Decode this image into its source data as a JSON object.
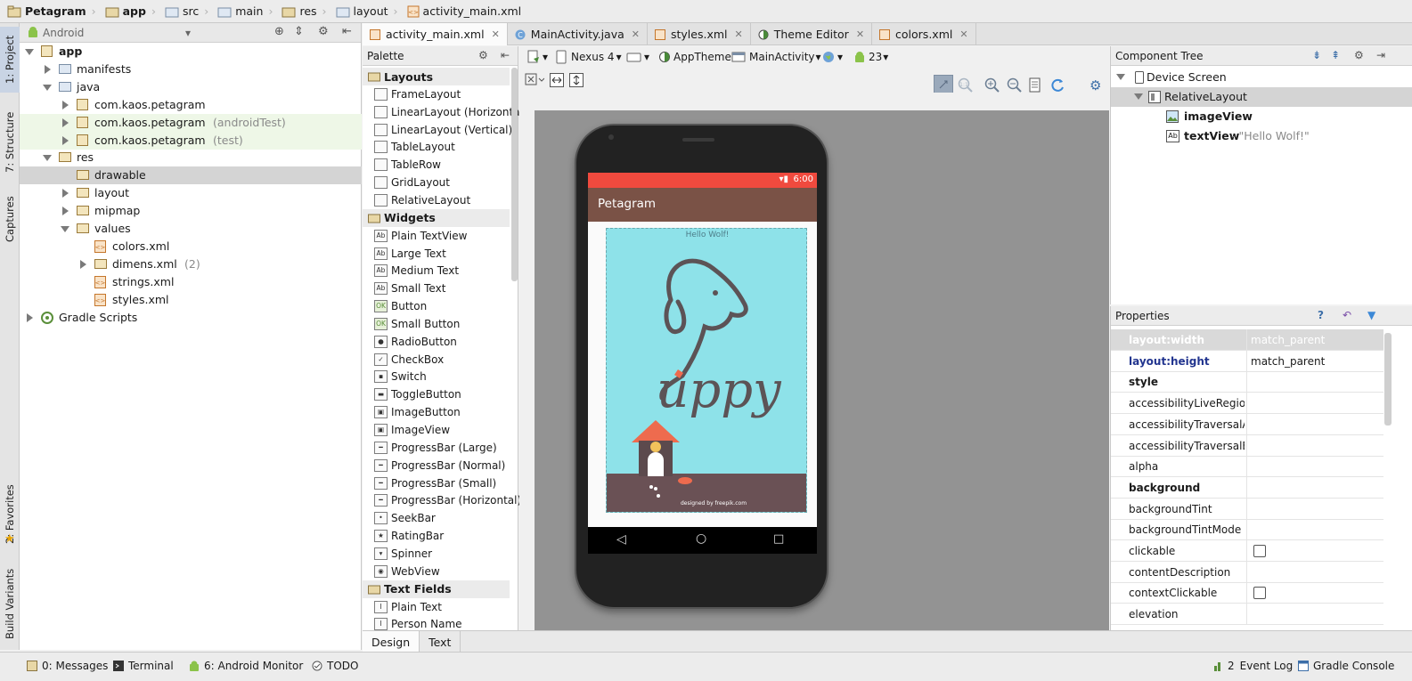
{
  "breadcrumb": [
    "Petagram",
    "app",
    "src",
    "main",
    "res",
    "layout",
    "activity_main.xml"
  ],
  "side_tabs": {
    "project": "1: Project",
    "structure": "7: Structure",
    "captures": "Captures",
    "favorites": "2: Favorites",
    "build_variants": "Build Variants"
  },
  "project_panel": {
    "view_selector": "Android"
  },
  "tree": [
    {
      "label": "app",
      "bold": true
    },
    {
      "label": "manifests"
    },
    {
      "label": "java"
    },
    {
      "label": "com.kaos.petagram",
      "suffix": ""
    },
    {
      "label": "com.kaos.petagram",
      "suffix": "(androidTest)"
    },
    {
      "label": "com.kaos.petagram",
      "suffix": "(test)"
    },
    {
      "label": "res"
    },
    {
      "label": "drawable"
    },
    {
      "label": "layout"
    },
    {
      "label": "mipmap"
    },
    {
      "label": "values"
    },
    {
      "label": "colors.xml"
    },
    {
      "label": "dimens.xml",
      "suffix": "(2)"
    },
    {
      "label": "strings.xml"
    },
    {
      "label": "styles.xml"
    },
    {
      "label": "Gradle Scripts"
    }
  ],
  "editor_tabs": [
    "activity_main.xml",
    "MainActivity.java",
    "styles.xml",
    "Theme Editor",
    "colors.xml"
  ],
  "palette": {
    "title": "Palette",
    "groups": {
      "layouts": {
        "label": "Layouts",
        "items": [
          "FrameLayout",
          "LinearLayout (Horizontal)",
          "LinearLayout (Vertical)",
          "TableLayout",
          "TableRow",
          "GridLayout",
          "RelativeLayout"
        ]
      },
      "widgets": {
        "label": "Widgets",
        "items": [
          "Plain TextView",
          "Large Text",
          "Medium Text",
          "Small Text",
          "Button",
          "Small Button",
          "RadioButton",
          "CheckBox",
          "Switch",
          "ToggleButton",
          "ImageButton",
          "ImageView",
          "ProgressBar (Large)",
          "ProgressBar (Normal)",
          "ProgressBar (Small)",
          "ProgressBar (Horizontal)",
          "SeekBar",
          "RatingBar",
          "Spinner",
          "WebView"
        ]
      },
      "text_fields": {
        "label": "Text Fields",
        "items": [
          "Plain Text",
          "Person Name"
        ]
      }
    }
  },
  "toolbar": {
    "device": "Nexus 4",
    "theme": "AppTheme",
    "activity": "MainActivity",
    "api": "23"
  },
  "device": {
    "status_time": "6:00",
    "app_title": "Petagram",
    "hello_text": "Hello Wolf!",
    "logo_text": "uppy",
    "credit": "designed by freepik.com",
    "colors": {
      "statusbar": "#f04a3e",
      "actionbar": "#7a5246",
      "background": "#8ee2e9",
      "ground": "#6a5155"
    }
  },
  "component_tree": {
    "title": "Component Tree",
    "nodes": [
      {
        "label": "Device Screen"
      },
      {
        "label": "RelativeLayout"
      },
      {
        "label": "imageView"
      },
      {
        "label": "textView",
        "detail": "- \"Hello Wolf!\""
      }
    ]
  },
  "properties": {
    "title": "Properties",
    "rows": [
      {
        "name": "layout:width",
        "value": "match_parent"
      },
      {
        "name": "layout:height",
        "value": "match_parent"
      },
      {
        "name": "style",
        "value": ""
      },
      {
        "name": "accessibilityLiveRegion",
        "value": ""
      },
      {
        "name": "accessibilityTraversalAfter",
        "value": ""
      },
      {
        "name": "accessibilityTraversalBefore",
        "value": ""
      },
      {
        "name": "alpha",
        "value": ""
      },
      {
        "name": "background",
        "value": ""
      },
      {
        "name": "backgroundTint",
        "value": ""
      },
      {
        "name": "backgroundTintMode",
        "value": ""
      },
      {
        "name": "clickable",
        "value": "",
        "checkbox": true
      },
      {
        "name": "contentDescription",
        "value": ""
      },
      {
        "name": "contextClickable",
        "value": "",
        "checkbox": true
      },
      {
        "name": "elevation",
        "value": ""
      }
    ]
  },
  "design_tabs": [
    "Design",
    "Text"
  ],
  "status_bar": {
    "messages": "0: Messages",
    "terminal": "Terminal",
    "android_monitor": "6: Android Monitor",
    "todo": "TODO",
    "event_log": "Event Log",
    "event_log_count": "2",
    "gradle_console": "Gradle Console"
  }
}
